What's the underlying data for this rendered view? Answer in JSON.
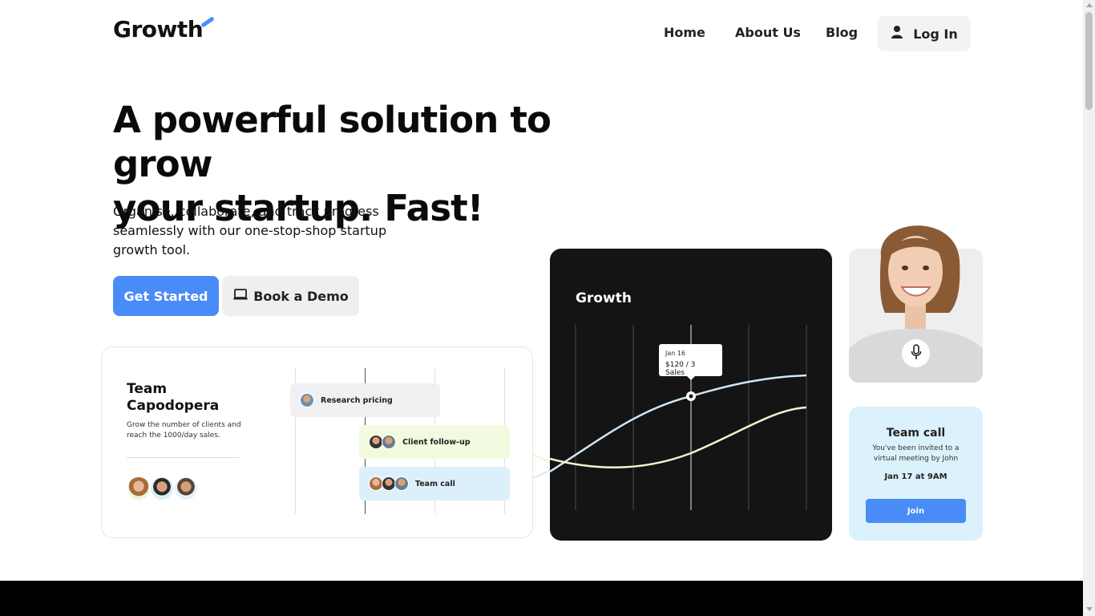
{
  "header": {
    "logo": "Growth",
    "nav": {
      "home": "Home",
      "about": "About Us",
      "blog": "Blog"
    },
    "login_label": "Log In"
  },
  "hero": {
    "headline_line1": "A powerful solution to grow",
    "headline_line2": "your startup. Fast!",
    "subtext": "Organise, collaborate, and track progress seamlessly with our one-stop-shop startup growth tool.",
    "primary_cta": "Get Started",
    "secondary_cta": "Book a Demo"
  },
  "team_card": {
    "title": "Team Capodopera",
    "description": "Grow the number of clients and reach the 1000/day sales.",
    "tasks": [
      {
        "label": "Research pricing",
        "color": "#f0f0f2"
      },
      {
        "label": "Client follow-up",
        "color": "#f2fbdf"
      },
      {
        "label": "Team call",
        "color": "#dcf0fb"
      }
    ]
  },
  "growth_card": {
    "title": "Growth",
    "tooltip_date": "Jan 16",
    "tooltip_value": "$120 / 3 Sales",
    "line_colors": [
      "#cfe6f7",
      "#f6f3cf"
    ]
  },
  "photo_card": {
    "icon": "microphone-icon"
  },
  "call_card": {
    "title": "Team call",
    "description": "You've been invited to a virtual meeting by John",
    "time": "Jan 17 at 9AM",
    "join_label": "Join"
  },
  "colors": {
    "accent": "#4a8cf7",
    "dark_card": "#141414",
    "call_card_bg": "#dbf1fb"
  }
}
